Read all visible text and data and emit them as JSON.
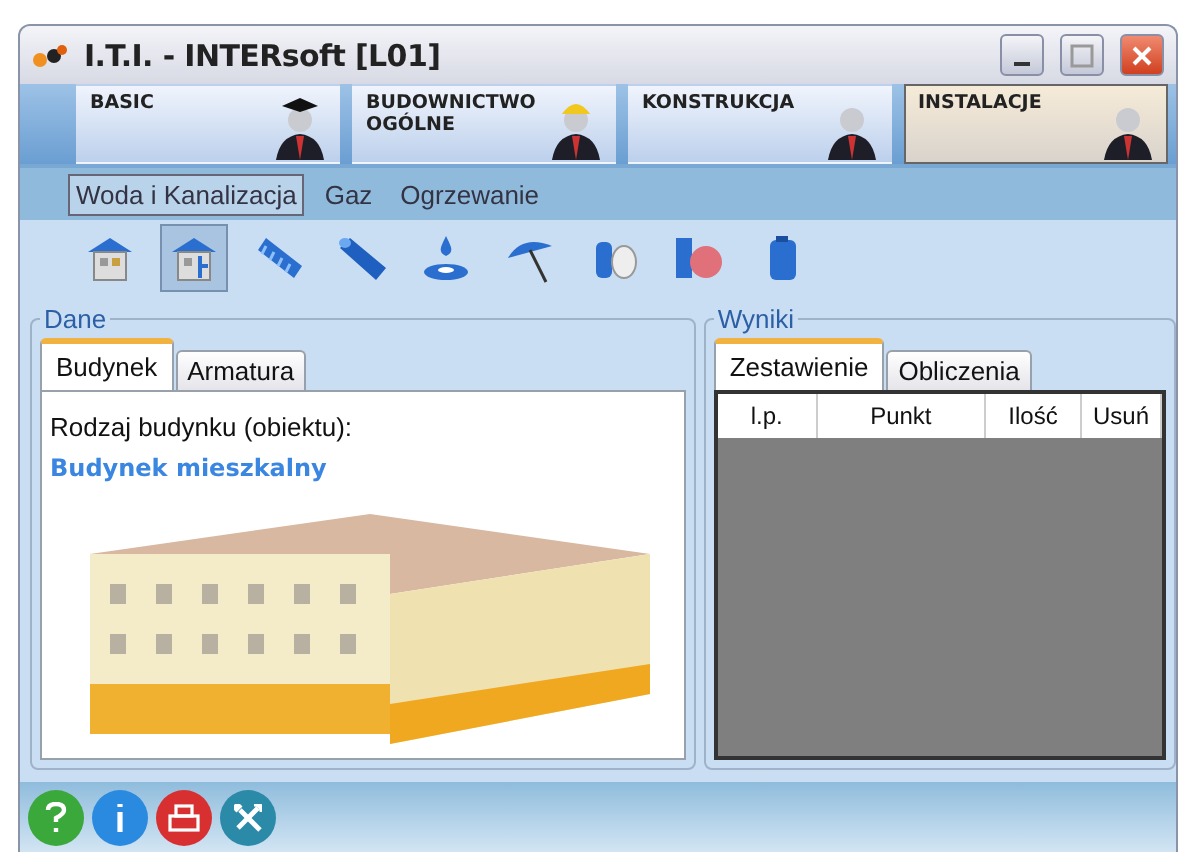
{
  "window": {
    "title": "I.T.I. - INTERsoft [L01]"
  },
  "modules": [
    {
      "label": "BASIC",
      "selected": false
    },
    {
      "label": "BUDOWNICTWO OGÓLNE",
      "selected": false
    },
    {
      "label": "KONSTRUKCJA",
      "selected": false
    },
    {
      "label": "INSTALACJE",
      "selected": true
    }
  ],
  "submenu": [
    {
      "label": "Woda i Kanalizacja",
      "selected": true
    },
    {
      "label": "Gaz",
      "selected": false
    },
    {
      "label": "Ogrzewanie",
      "selected": false
    }
  ],
  "toolbar": [
    {
      "kind": "house",
      "selected": false
    },
    {
      "kind": "house-pipe",
      "selected": true
    },
    {
      "kind": "coil",
      "selected": false
    },
    {
      "kind": "tube",
      "selected": false
    },
    {
      "kind": "drop",
      "selected": false
    },
    {
      "kind": "umbrella",
      "selected": false
    },
    {
      "kind": "valve",
      "selected": false
    },
    {
      "kind": "pump",
      "selected": false
    },
    {
      "kind": "tank",
      "selected": false
    }
  ],
  "data_panel": {
    "title": "Dane",
    "tabs": [
      {
        "label": "Budynek",
        "selected": true
      },
      {
        "label": "Armatura",
        "selected": false
      }
    ],
    "label": "Rodzaj budynku (obiektu):",
    "value": "Budynek mieszkalny"
  },
  "results_panel": {
    "title": "Wyniki",
    "tabs": [
      {
        "label": "Zestawienie",
        "selected": true
      },
      {
        "label": "Obliczenia",
        "selected": false
      }
    ],
    "columns": [
      "l.p.",
      "Punkt",
      "Ilość",
      "Usuń"
    ]
  },
  "footer": [
    {
      "kind": "help"
    },
    {
      "kind": "info"
    },
    {
      "kind": "print"
    },
    {
      "kind": "tools"
    }
  ]
}
